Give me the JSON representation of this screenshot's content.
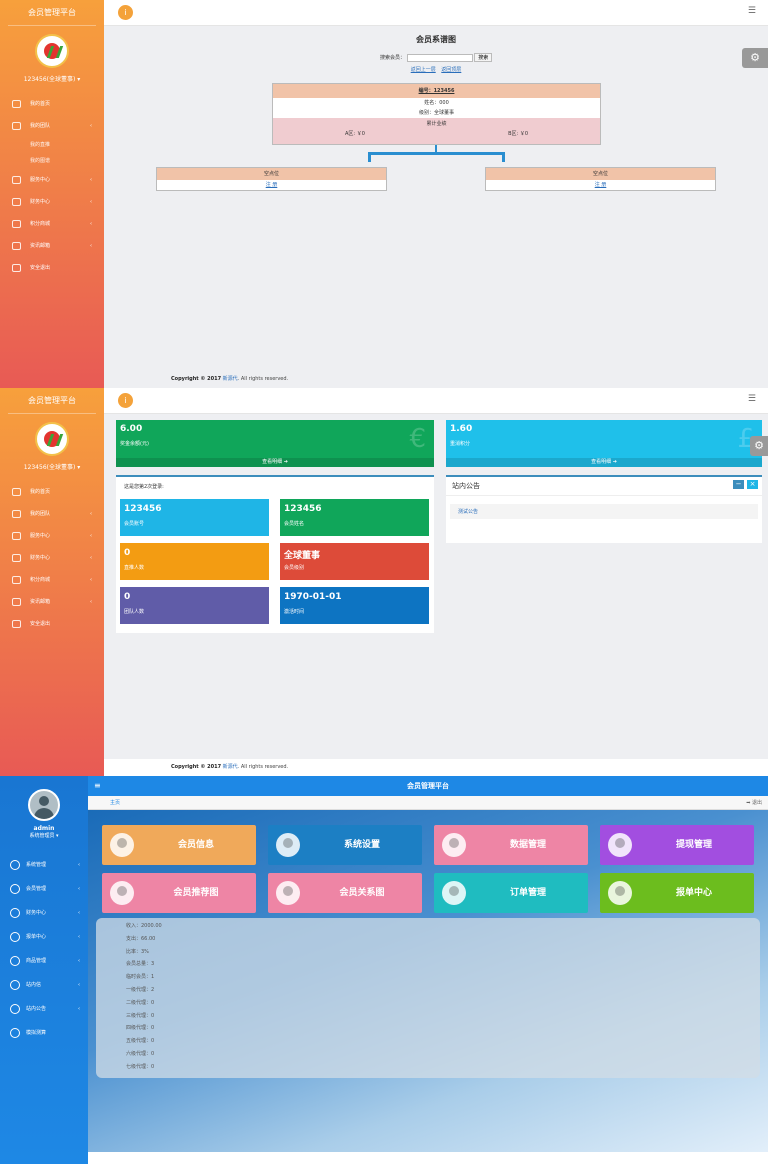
{
  "s1": {
    "brand": "会员管理平台",
    "user": "123456(全球董事) ▾",
    "nav": [
      {
        "label": "我的首页",
        "type": "item"
      },
      {
        "label": "我的团队",
        "type": "group",
        "arrow": "‹"
      },
      {
        "label": "我的直推",
        "type": "sub"
      },
      {
        "label": "我的图谱",
        "type": "sub"
      },
      {
        "label": "服务中心",
        "type": "group",
        "arrow": "‹"
      },
      {
        "label": "财务中心",
        "type": "group",
        "arrow": "‹"
      },
      {
        "label": "积分商城",
        "type": "group",
        "arrow": "‹"
      },
      {
        "label": "资讯邮箱",
        "type": "group",
        "arrow": "‹"
      },
      {
        "label": "安全退出",
        "type": "item"
      }
    ],
    "tree_title": "会员系谱图",
    "search_label": "搜索会员：",
    "search_value": "",
    "search_button": "搜索",
    "link_back": "返回上一层",
    "link_top": "返回顶层",
    "root": {
      "id": "编号：123456",
      "name": "姓名：000",
      "level": "级别：全球董事",
      "perf_title": "累计业绩",
      "a_area": "A区: ￥0",
      "b_area": "B区: ￥0"
    },
    "left_node": {
      "title": "空点位",
      "action": "注 册"
    },
    "right_node": {
      "title": "空点位",
      "action": "注 册"
    },
    "copyright": "Copyright © 2017",
    "company": "新源代",
    "rights": ". All rights reserved."
  },
  "s2": {
    "brand": "会员管理平台",
    "user": "123456(全球董事) ▾",
    "nav": [
      {
        "label": "我的首页",
        "arrow": ""
      },
      {
        "label": "我的团队",
        "arrow": "‹"
      },
      {
        "label": "服务中心",
        "arrow": "‹"
      },
      {
        "label": "财务中心",
        "arrow": "‹"
      },
      {
        "label": "积分商城",
        "arrow": "‹"
      },
      {
        "label": "资讯邮箱",
        "arrow": "‹"
      },
      {
        "label": "安全退出",
        "arrow": ""
      }
    ],
    "balance": {
      "value": "6.00",
      "label": "奖金余额(元)",
      "footer": "查看明细 ➔",
      "symbol": "€"
    },
    "points": {
      "value": "1.60",
      "label": "重消积分",
      "footer": "查看明细 ➔",
      "symbol": "£"
    },
    "login_info": "这是您第2次登录:",
    "metrics": [
      {
        "value": "123456",
        "label": "会员账号",
        "color": "#1fb5e6"
      },
      {
        "value": "123456",
        "label": "会员姓名",
        "color": "#10a65a"
      },
      {
        "value": "0",
        "label": "直推人数",
        "color": "#f39c12"
      },
      {
        "value": "全球董事",
        "label": "会员级别",
        "color": "#dd4b39"
      },
      {
        "value": "0",
        "label": "团队人数",
        "color": "#605ca8"
      },
      {
        "value": "1970-01-01",
        "label": "激活时间",
        "color": "#0d74c2"
      }
    ],
    "notice_title": "站内公告",
    "notice_item": "测试公告",
    "copyright": "Copyright © 2017",
    "company": "新源代",
    "rights": ". All rights reserved."
  },
  "s3": {
    "admin_name": "admin",
    "admin_role": "系统管理员 ▾",
    "header_title": "会员管理平台",
    "home": "主页",
    "logout": "➡ 退出",
    "nav": [
      {
        "label": "系统管理",
        "arrow": "‹"
      },
      {
        "label": "会员管理",
        "arrow": "‹"
      },
      {
        "label": "财务中心",
        "arrow": "‹"
      },
      {
        "label": "报单中心",
        "arrow": "‹"
      },
      {
        "label": "商品管理",
        "arrow": "‹"
      },
      {
        "label": "站内信",
        "arrow": "‹"
      },
      {
        "label": "站内公告",
        "arrow": "‹"
      },
      {
        "label": "模拟测算",
        "arrow": ""
      }
    ],
    "tiles": [
      {
        "label": "会员信息",
        "color": "#f0a95a"
      },
      {
        "label": "系统设置",
        "color": "#1c7fc4"
      },
      {
        "label": "数据管理",
        "color": "#ee85a5"
      },
      {
        "label": "提现管理",
        "color": "#a24ee0"
      },
      {
        "label": "会员推荐图",
        "color": "#ee85a5"
      },
      {
        "label": "会员关系图",
        "color": "#ee85a5"
      },
      {
        "label": "订单管理",
        "color": "#1fbcc0"
      },
      {
        "label": "报单中心",
        "color": "#6cbd1e"
      }
    ],
    "stats": [
      "收入：2000.00",
      "支出：66.00",
      "比率：3%",
      "会员总量：3",
      "临时会员：1",
      "一级代理：2",
      "二级代理：0",
      "三级代理：0",
      "四级代理：0",
      "五级代理：0",
      "六级代理：0",
      "七级代理：0"
    ]
  }
}
